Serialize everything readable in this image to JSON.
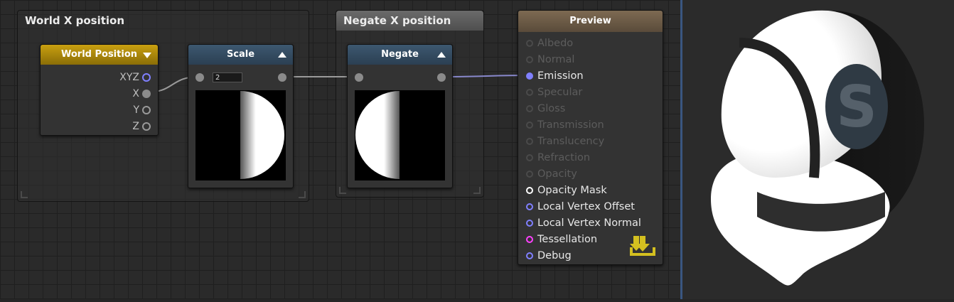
{
  "frames": {
    "world_x": {
      "title": "World X position"
    },
    "negate_x": {
      "title": "Negate X position"
    }
  },
  "nodes": {
    "world_position": {
      "title": "World Position",
      "outputs": [
        "XYZ",
        "X",
        "Y",
        "Z"
      ]
    },
    "scale": {
      "title": "Scale",
      "value": "2"
    },
    "negate": {
      "title": "Negate"
    },
    "preview": {
      "title": "Preview",
      "inputs": [
        {
          "label": "Albedo",
          "active": false
        },
        {
          "label": "Normal",
          "active": false
        },
        {
          "label": "Emission",
          "active": true
        },
        {
          "label": "Specular",
          "active": false
        },
        {
          "label": "Gloss",
          "active": false
        },
        {
          "label": "Transmission",
          "active": false
        },
        {
          "label": "Translucency",
          "active": false
        },
        {
          "label": "Refraction",
          "active": false
        },
        {
          "label": "Opacity",
          "active": false
        },
        {
          "label": "Opacity Mask",
          "active": true
        },
        {
          "label": "Local Vertex Offset",
          "active": true
        },
        {
          "label": "Local Vertex Normal",
          "active": true
        },
        {
          "label": "Tessellation",
          "active": true
        },
        {
          "label": "Debug",
          "active": true
        }
      ]
    }
  },
  "viewport": {
    "logo_letter": "S"
  },
  "colors": {
    "port_blue": "#8080ff",
    "port_white": "#ffffff",
    "port_magenta": "#ff40ff",
    "port_inactive": "#4a4a4a",
    "text_active": "#e8e8e8",
    "text_inactive": "#5c5c5c",
    "connection": "#8888cc",
    "save_icon": "#d4c020"
  },
  "icons": {
    "save": "download-tray-icon"
  }
}
